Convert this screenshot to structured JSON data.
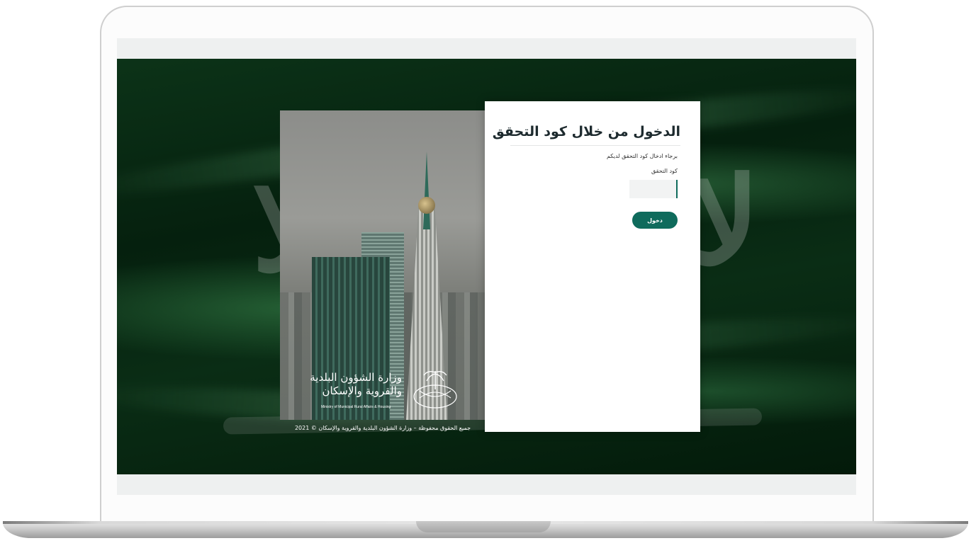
{
  "card": {
    "title": "الدخول من خلال كود التحقق",
    "hint": "برجاء ادخال كود التحقق لديكم",
    "code_label": "كود التحقق",
    "code_value": "",
    "code_placeholder": "",
    "login_label": "دخول"
  },
  "ministry": {
    "name_line1": "وزارة الشؤون البلدية",
    "name_line2": "والقروية والإسكان",
    "name_en": "Ministry of Municipal Rural Affairs & Housing"
  },
  "footer": {
    "copyright": "جميع الحقوق محفوظة – وزارة الشؤون البلدية والقروية والإسكان © 2021"
  },
  "colors": {
    "accent": "#0f6b5c",
    "flag_green": "#05200e"
  }
}
